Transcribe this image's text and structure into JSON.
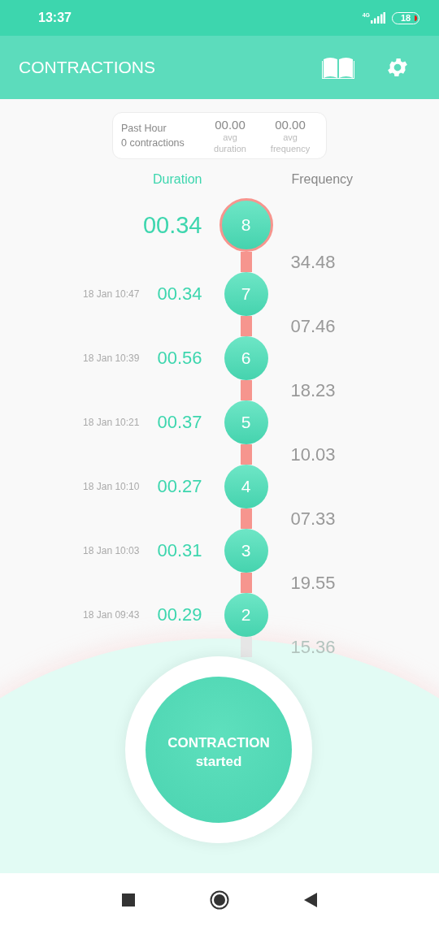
{
  "status_bar": {
    "time": "13:37",
    "network": "4G",
    "battery": "18"
  },
  "app_bar": {
    "title": "CONTRACTIONS"
  },
  "summary": {
    "period": "Past Hour",
    "count": "0 contractions",
    "avg_duration": "00.00",
    "avg_duration_label": "avg duration",
    "avg_frequency": "00.00",
    "avg_frequency_label": "avg frequency"
  },
  "columns": {
    "duration": "Duration",
    "frequency": "Frequency"
  },
  "timeline": [
    {
      "kind": "contraction",
      "number": "8",
      "duration": "00.34",
      "active": true
    },
    {
      "kind": "frequency",
      "value": "34.48",
      "faded": false
    },
    {
      "kind": "contraction",
      "number": "7",
      "date": "18 Jan 10:47",
      "duration": "00.34",
      "active": false
    },
    {
      "kind": "frequency",
      "value": "07.46",
      "faded": false
    },
    {
      "kind": "contraction",
      "number": "6",
      "date": "18 Jan 10:39",
      "duration": "00.56",
      "active": false
    },
    {
      "kind": "frequency",
      "value": "18.23",
      "faded": false
    },
    {
      "kind": "contraction",
      "number": "5",
      "date": "18 Jan 10:21",
      "duration": "00.37",
      "active": false
    },
    {
      "kind": "frequency",
      "value": "10.03",
      "faded": false
    },
    {
      "kind": "contraction",
      "number": "4",
      "date": "18 Jan 10:10",
      "duration": "00.27",
      "active": false
    },
    {
      "kind": "frequency",
      "value": "07.33",
      "faded": false
    },
    {
      "kind": "contraction",
      "number": "3",
      "date": "18 Jan 10:03",
      "duration": "00.31",
      "active": false
    },
    {
      "kind": "frequency",
      "value": "19.55",
      "faded": false
    },
    {
      "kind": "contraction",
      "number": "2",
      "date": "18 Jan 09:43",
      "duration": "00.29",
      "active": false
    },
    {
      "kind": "frequency",
      "value": "15.36",
      "faded": true
    }
  ],
  "main_button": {
    "line1": "CONTRACTION",
    "line2": "started"
  }
}
